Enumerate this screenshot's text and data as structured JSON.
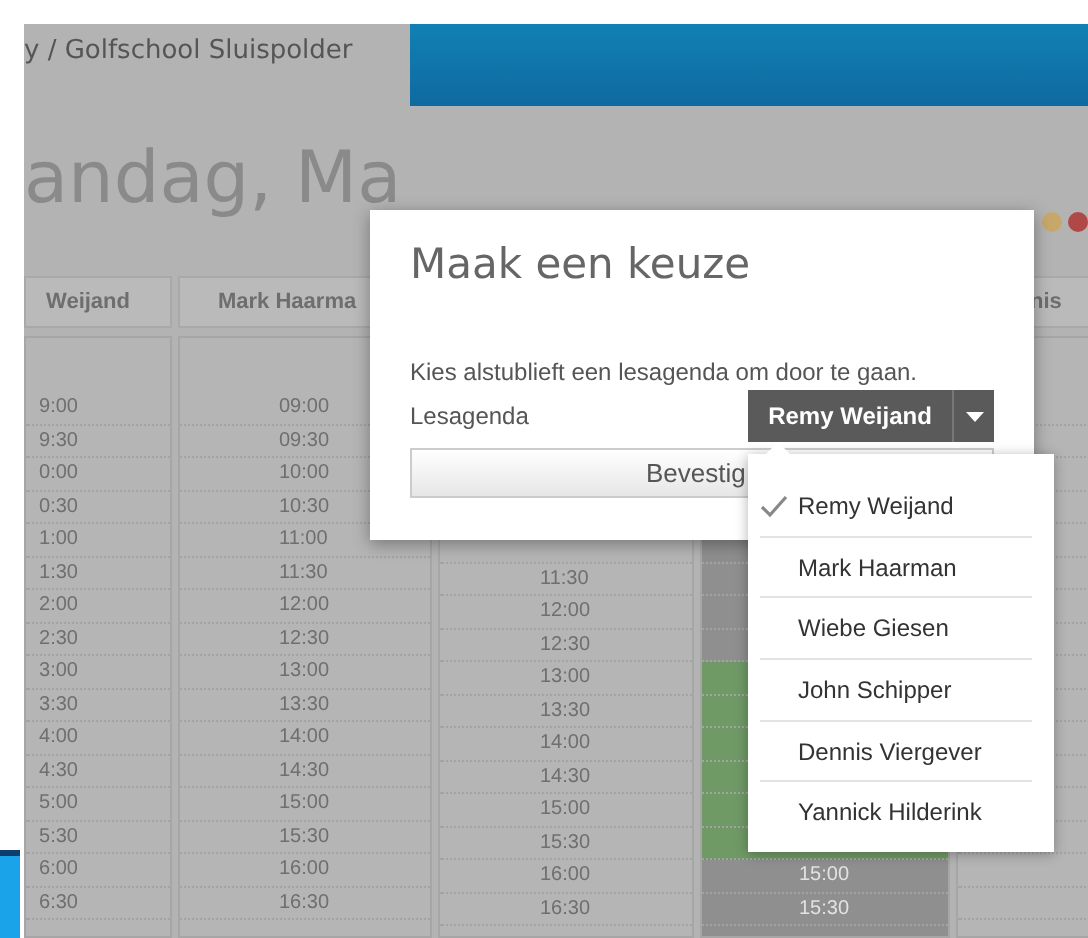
{
  "header": {
    "breadcrumb": "y / Golfschool Sluispolder"
  },
  "day_title": "andag, Ma",
  "columns": [
    {
      "name": "Weijand",
      "slots": [
        {
          "kind": "time",
          "time": "9:00"
        },
        {
          "kind": "time",
          "time": "9:30"
        },
        {
          "kind": "time",
          "time": "0:00"
        },
        {
          "kind": "time",
          "time": "0:30"
        },
        {
          "kind": "time",
          "time": "1:00"
        },
        {
          "kind": "time",
          "time": "1:30"
        },
        {
          "kind": "time",
          "time": "2:00"
        },
        {
          "kind": "time",
          "time": "2:30"
        },
        {
          "kind": "time",
          "time": "3:00"
        },
        {
          "kind": "time",
          "time": "3:30"
        },
        {
          "kind": "time",
          "time": "4:00"
        },
        {
          "kind": "time",
          "time": "4:30"
        },
        {
          "kind": "time",
          "time": "5:00"
        },
        {
          "kind": "time",
          "time": "5:30"
        },
        {
          "kind": "time",
          "time": "6:00"
        },
        {
          "kind": "time",
          "time": "6:30"
        }
      ]
    },
    {
      "name": "Mark Haarma",
      "slots": [
        {
          "kind": "time",
          "time": "09:00"
        },
        {
          "kind": "time",
          "time": "09:30"
        },
        {
          "kind": "time",
          "time": "10:00"
        },
        {
          "kind": "time",
          "time": "10:30"
        },
        {
          "kind": "time",
          "time": "11:00"
        },
        {
          "kind": "time",
          "time": "11:30"
        },
        {
          "kind": "time",
          "time": "12:00"
        },
        {
          "kind": "time",
          "time": "12:30"
        },
        {
          "kind": "time",
          "time": "13:00"
        },
        {
          "kind": "time",
          "time": "13:30"
        },
        {
          "kind": "time",
          "time": "14:00"
        },
        {
          "kind": "time",
          "time": "14:30"
        },
        {
          "kind": "time",
          "time": "15:00"
        },
        {
          "kind": "time",
          "time": "15:30"
        },
        {
          "kind": "time",
          "time": "16:00"
        },
        {
          "kind": "time",
          "time": "16:30"
        }
      ]
    },
    {
      "slots": [
        {
          "kind": "blank"
        },
        {
          "kind": "blank"
        },
        {
          "kind": "blank"
        },
        {
          "kind": "blank"
        },
        {
          "kind": "blank"
        },
        {
          "kind": "time",
          "time": "11:30"
        },
        {
          "kind": "time",
          "time": "12:00"
        },
        {
          "kind": "time",
          "time": "12:30"
        },
        {
          "kind": "time",
          "time": "13:00"
        },
        {
          "kind": "time",
          "time": "13:30"
        },
        {
          "kind": "time",
          "time": "14:00"
        },
        {
          "kind": "time",
          "time": "14:30"
        },
        {
          "kind": "time",
          "time": "15:00"
        },
        {
          "kind": "time",
          "time": "15:30"
        },
        {
          "kind": "time",
          "time": "16:00"
        },
        {
          "kind": "time",
          "time": "16:30"
        }
      ]
    },
    {
      "kind": "dark",
      "slots": [
        {
          "kind": "blank"
        },
        {
          "kind": "blank"
        },
        {
          "kind": "blank"
        },
        {
          "kind": "blank"
        },
        {
          "kind": "blank"
        },
        {
          "kind": "blank"
        },
        {
          "kind": "blank"
        },
        {
          "kind": "blank"
        },
        {
          "kind": "booked"
        },
        {
          "kind": "booked"
        },
        {
          "kind": "booked"
        },
        {
          "kind": "booked"
        },
        {
          "kind": "booked"
        },
        {
          "kind": "booked"
        },
        {
          "kind": "time",
          "time": "15:00"
        },
        {
          "kind": "time",
          "time": "15:30"
        }
      ]
    },
    {
      "name": "nis",
      "slots": [
        {
          "kind": "blank"
        },
        {
          "kind": "blank"
        },
        {
          "kind": "blank"
        },
        {
          "kind": "blank"
        },
        {
          "kind": "blank"
        },
        {
          "kind": "blank"
        },
        {
          "kind": "blank"
        },
        {
          "kind": "blank"
        },
        {
          "kind": "blank"
        },
        {
          "kind": "blank"
        },
        {
          "kind": "blank"
        },
        {
          "kind": "blank"
        },
        {
          "kind": "blank"
        },
        {
          "kind": "blank"
        },
        {
          "kind": "blank"
        },
        {
          "kind": "blank"
        }
      ]
    }
  ],
  "dialog": {
    "title": "Maak een keuze",
    "message": "Kies alstublieft een lesagenda om door te gaan.",
    "label": "Lesagenda",
    "dropdown": {
      "value": "Remy Weijand",
      "expanded": true
    },
    "confirm_button": "Bevestig",
    "options": [
      {
        "label": "Remy Weijand",
        "selected": true
      },
      {
        "label": "Mark Haarman",
        "selected": false
      },
      {
        "label": "Wiebe Giesen",
        "selected": false
      },
      {
        "label": "John Schipper",
        "selected": false
      },
      {
        "label": "Dennis Viergever",
        "selected": false
      },
      {
        "label": "Yannick Hilderink",
        "selected": false
      }
    ]
  }
}
